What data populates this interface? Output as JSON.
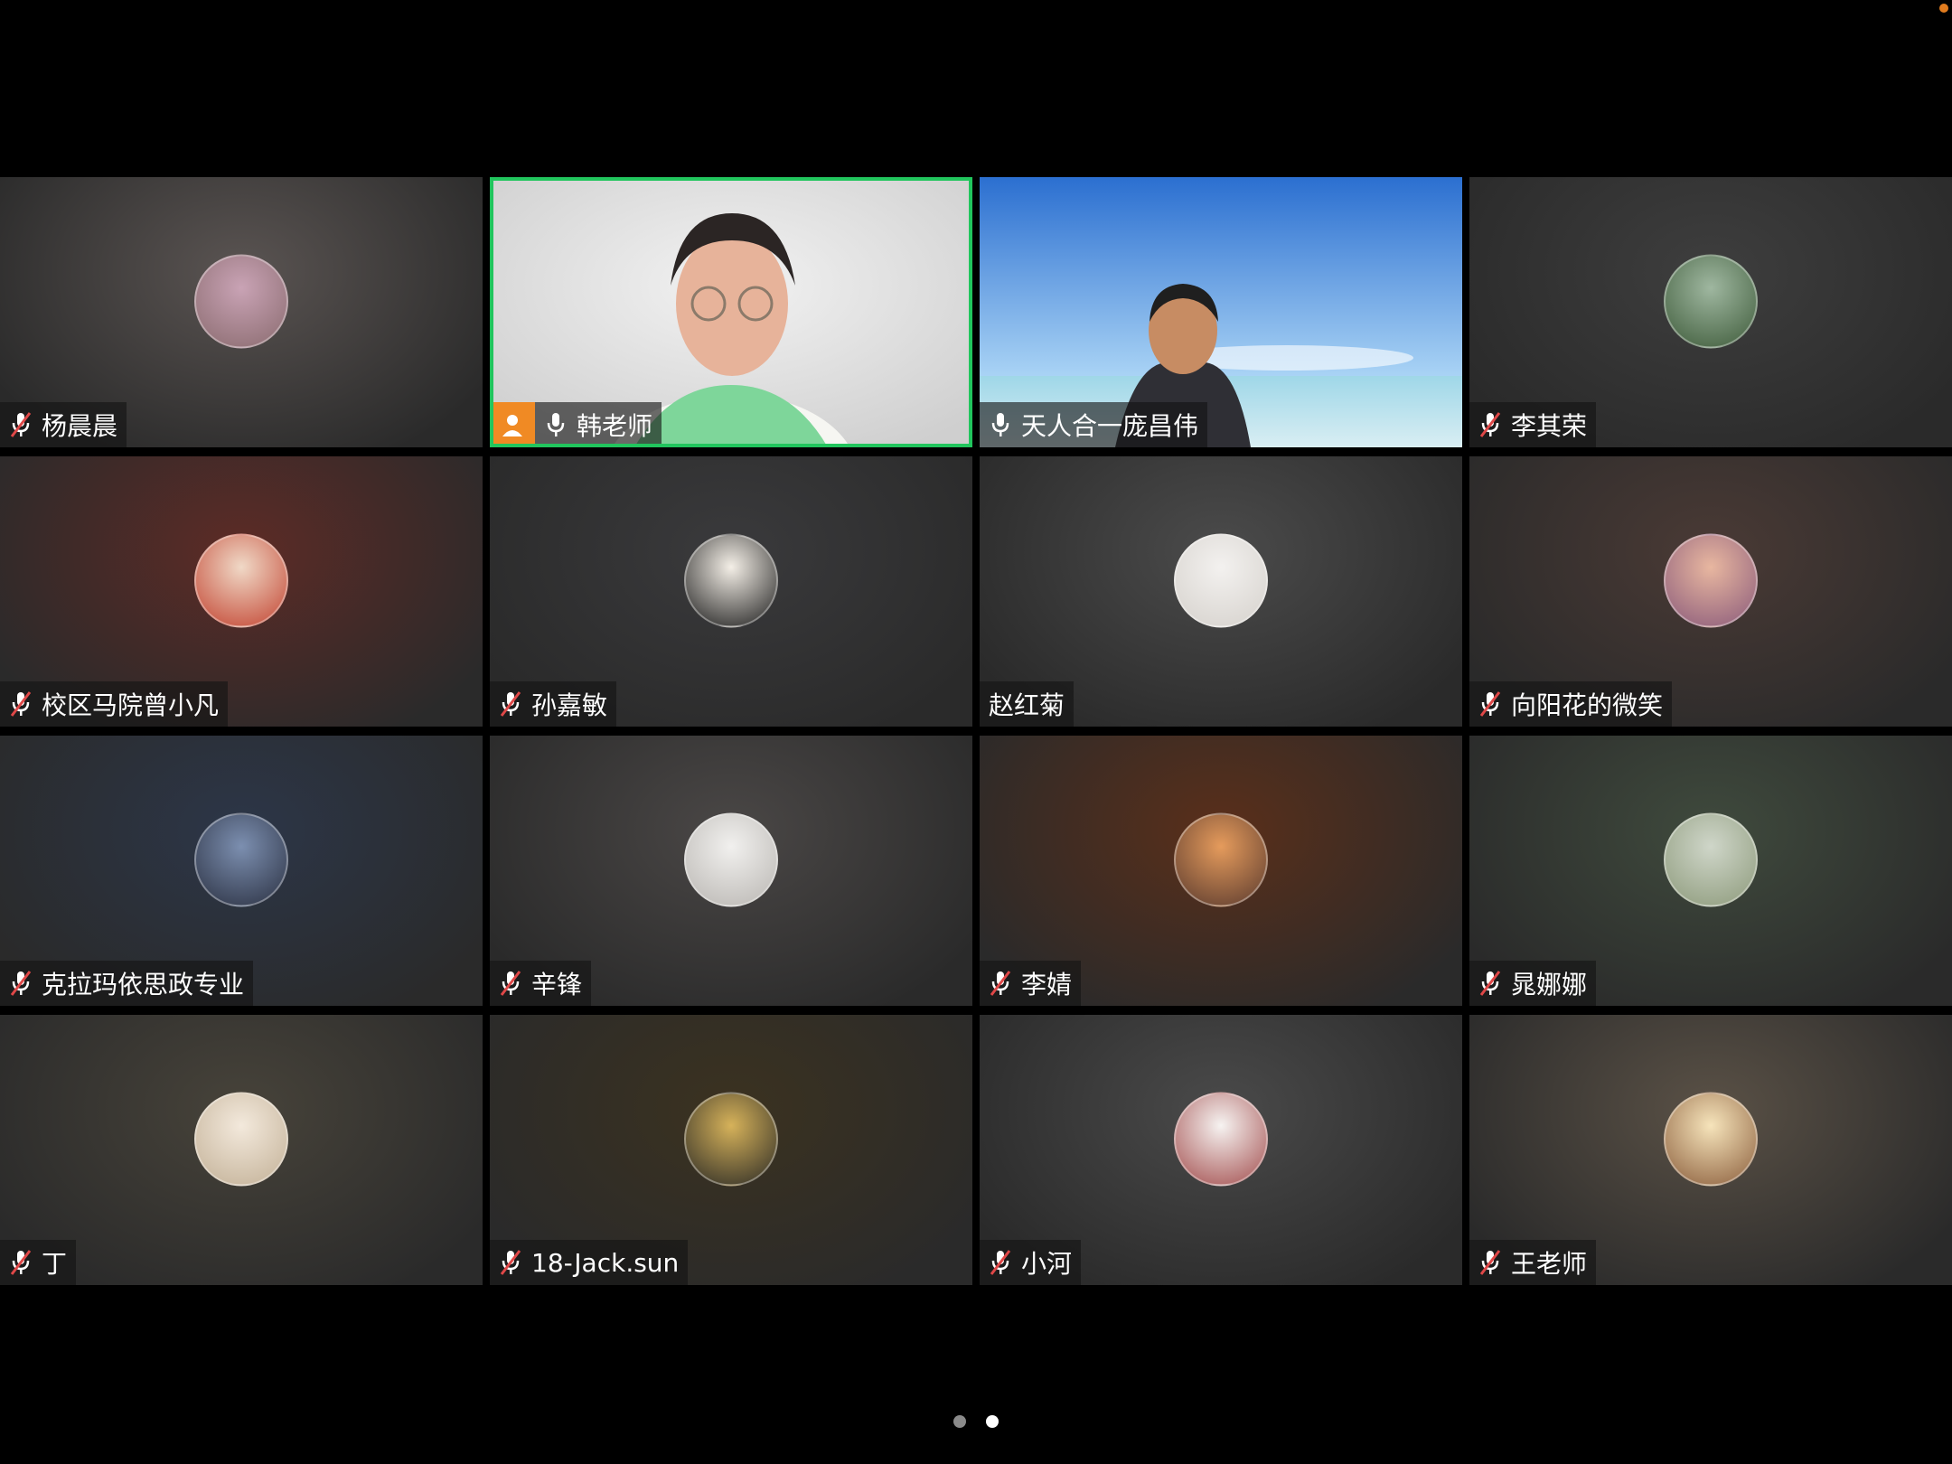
{
  "meeting": {
    "current_page": 2,
    "pages": 2,
    "participants": [
      {
        "name": "杨晨晨",
        "mic": "muted",
        "host": false,
        "video": false,
        "bg": "#5a5452",
        "avatar_colors": [
          "#c9a3b5",
          "#8a6b6f"
        ]
      },
      {
        "name": "韩老师",
        "mic": "on",
        "host": true,
        "video": true,
        "active_speaker": true,
        "bg": "#dcdcdc"
      },
      {
        "name": "天人合一庞昌伟",
        "mic": "on",
        "host": false,
        "video": true,
        "bg": "#3a7bd0"
      },
      {
        "name": "李其荣",
        "mic": "muted",
        "host": false,
        "video": false,
        "bg": "#3e3e3e",
        "avatar_colors": [
          "#9fb7a0",
          "#3e5b3a"
        ]
      },
      {
        "name": "校区马院曾小凡",
        "mic": "muted",
        "host": false,
        "video": false,
        "bg": "#5d2b26",
        "avatar_colors": [
          "#f0d9c7",
          "#c24330"
        ]
      },
      {
        "name": "孙嘉敏",
        "mic": "muted",
        "host": false,
        "video": false,
        "bg": "#3a3a3c",
        "avatar_colors": [
          "#f4efe7",
          "#1d1d1d"
        ]
      },
      {
        "name": "赵红菊",
        "mic": "none",
        "host": false,
        "video": false,
        "bg": "#4b4b4b",
        "avatar_colors": [
          "#f3f1ef",
          "#d5d1cc"
        ]
      },
      {
        "name": "向阳花的微笑",
        "mic": "muted",
        "host": false,
        "video": false,
        "bg": "#4a3a35",
        "avatar_colors": [
          "#e8b7a0",
          "#8a5a7a"
        ]
      },
      {
        "name": "克拉玛依思政专业",
        "mic": "muted",
        "host": false,
        "video": false,
        "bg": "#2c3648",
        "avatar_colors": [
          "#7c8fb0",
          "#2b3142"
        ]
      },
      {
        "name": "辛锋",
        "mic": "muted",
        "host": false,
        "video": false,
        "bg": "#4a4746",
        "avatar_colors": [
          "#f1f0ee",
          "#b9b6b2"
        ]
      },
      {
        "name": "李婧",
        "mic": "muted",
        "host": false,
        "video": false,
        "bg": "#5a2f1a",
        "avatar_colors": [
          "#e59b5c",
          "#5a3a2e"
        ]
      },
      {
        "name": "晁娜娜",
        "mic": "muted",
        "host": false,
        "video": false,
        "bg": "#3f4a3d",
        "avatar_colors": [
          "#cfd6c9",
          "#8d9a7b"
        ]
      },
      {
        "name": "丁",
        "mic": "muted",
        "host": false,
        "video": false,
        "bg": "#47433a",
        "avatar_colors": [
          "#f3e9dc",
          "#c2b096"
        ]
      },
      {
        "name": "18-Jack.sun",
        "mic": "muted",
        "host": false,
        "video": false,
        "bg": "#3b3220",
        "avatar_colors": [
          "#d6b25a",
          "#2b2a25"
        ]
      },
      {
        "name": "小河",
        "mic": "muted",
        "host": false,
        "video": false,
        "bg": "#4a4a4a",
        "avatar_colors": [
          "#f6f3f1",
          "#a24d4d"
        ]
      },
      {
        "name": "王老师",
        "mic": "muted",
        "host": false,
        "video": false,
        "bg": "#5a5146",
        "avatar_colors": [
          "#f6e4bb",
          "#8b5e3c"
        ]
      }
    ]
  },
  "colors": {
    "active_border": "#21c55d",
    "host_badge": "#f08a24",
    "muted_slash": "#e04848"
  }
}
